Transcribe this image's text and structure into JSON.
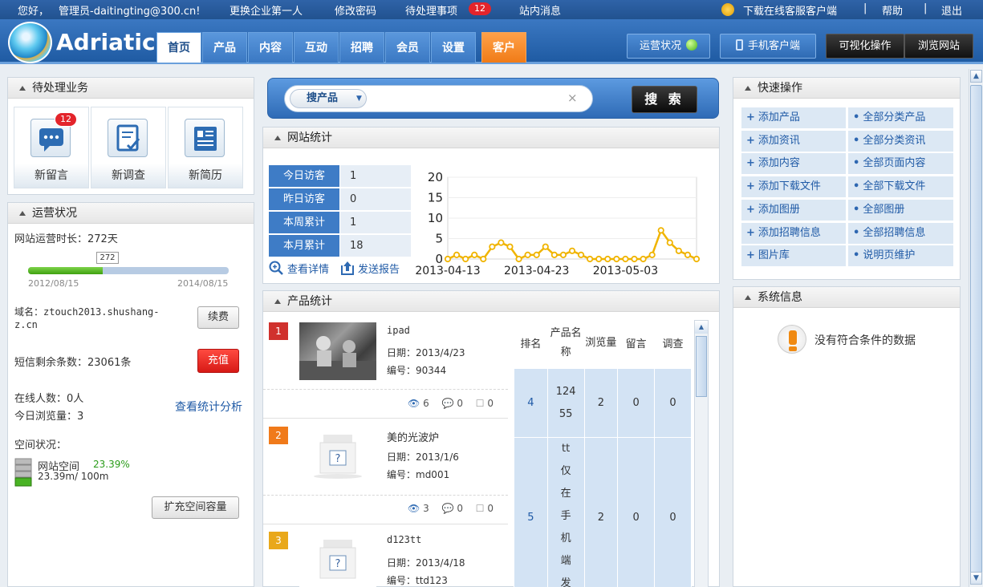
{
  "topbar": {
    "greeting": "您好，",
    "user": "管理员-daitingting@300.cn!",
    "switch_company": "更换企业第一人",
    "change_password": "修改密码",
    "pending": "待处理事项",
    "pending_count": "12",
    "messages": "站内消息",
    "download_client": "下载在线客服客户端",
    "help": "帮助",
    "logout": "退出",
    "separator": "|"
  },
  "header": {
    "logo": "Adriatic",
    "tabs": [
      "首页",
      "产品",
      "内容",
      "互动",
      "招聘",
      "会员",
      "设置"
    ],
    "client_tab": "客户",
    "status_btn": "运营状况",
    "mobile_btn": "手机客户端",
    "visual_btn": "可视化操作",
    "browse_btn": "浏览网站"
  },
  "pending_panel": {
    "title": "待处理业务",
    "items": [
      {
        "label": "新留言",
        "count": "12",
        "icon": "message-icon"
      },
      {
        "label": "新调查",
        "icon": "survey-icon"
      },
      {
        "label": "新简历",
        "icon": "resume-icon"
      }
    ]
  },
  "ops_panel": {
    "title": "运营状况",
    "uptime": "网站运营时长：272天",
    "progress_value": "272",
    "progress_fraction": 0.37,
    "start_date": "2012/08/15",
    "end_date": "2014/08/15",
    "domain": "域名：ztouch2013.shushang-z.cn",
    "renew": "续费",
    "sms": "短信剩余条数：23061条",
    "recharge": "充值",
    "online": "在线人数：0人",
    "today_views": "今日浏览量：3",
    "stats_link": "查看统计分析",
    "space_title": "空间状况：",
    "space_label": "网站空间",
    "space_percent": "23.39%",
    "space_usage": "23.39m/ 100m",
    "expand": "扩充空间容量"
  },
  "search": {
    "category": "搜产品",
    "clear": "×",
    "button": "搜 索"
  },
  "site_stats": {
    "title": "网站统计",
    "rows": [
      {
        "label": "今日访客",
        "value": "1"
      },
      {
        "label": "昨日访客",
        "value": "0"
      },
      {
        "label": "本周累计",
        "value": "1"
      },
      {
        "label": "本月累计",
        "value": "18"
      }
    ],
    "details": "查看详情",
    "report": "发送报告"
  },
  "chart_data": {
    "type": "line",
    "ylim": [
      0,
      20
    ],
    "yticks": [
      "20",
      "15",
      "10",
      "5",
      "0"
    ],
    "xticks": [
      "2013-04-13",
      "2013-04-23",
      "2013-05-03"
    ],
    "x_start": "2013-04-13",
    "values": [
      0,
      1,
      0,
      1,
      0,
      3,
      4,
      3,
      0,
      1,
      1,
      3,
      1,
      1,
      2,
      1,
      0,
      0,
      0,
      0,
      0,
      0,
      0,
      1,
      7,
      4,
      2,
      1,
      0
    ],
    "color": "#f0b400"
  },
  "product_stats": {
    "title": "产品统计",
    "products": [
      {
        "rank": "1",
        "name": "ipad",
        "date": "日期：2013/4/23",
        "code": "编号：90344",
        "views": "6",
        "comments": "0",
        "surveys": "0",
        "color": "#d0312d"
      },
      {
        "rank": "2",
        "name": "美的光波炉",
        "date": "日期：2013/1/6",
        "code": "编号：md001",
        "views": "3",
        "comments": "0",
        "surveys": "0",
        "color": "#f07a1a"
      },
      {
        "rank": "3",
        "name": "d123tt",
        "date": "日期：2013/4/18",
        "code": "编号：ttd123",
        "color": "#e9a81a"
      }
    ],
    "rank_headers": [
      "排名",
      "产品名称",
      "浏览量",
      "留言",
      "调查"
    ],
    "rank_rows": [
      {
        "rank": "4",
        "name": "12455",
        "views": "2",
        "comments": "0",
        "surveys": "0"
      },
      {
        "rank": "5",
        "name": "tt仅在手机端发",
        "views": "2",
        "comments": "0",
        "surveys": "0"
      }
    ]
  },
  "quick_ops": {
    "title": "快速操作",
    "left": [
      "添加产品",
      "添加资讯",
      "添加内容",
      "添加下载文件",
      "添加图册",
      "添加招聘信息",
      "图片库"
    ],
    "right": [
      "全部分类产品",
      "全部分类资讯",
      "全部页面内容",
      "全部下载文件",
      "全部图册",
      "全部招聘信息",
      "说明页维护"
    ]
  },
  "system_info": {
    "title": "系统信息",
    "empty": "没有符合条件的数据"
  }
}
